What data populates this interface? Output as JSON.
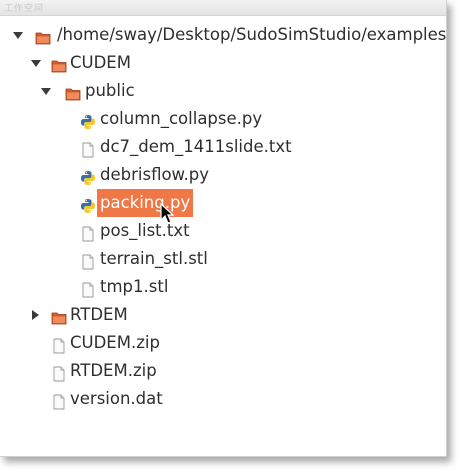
{
  "window": {
    "title": "工作空间"
  },
  "colors": {
    "selection": "#f07746",
    "folder": "#e05a2b"
  },
  "tree": [
    {
      "label": "/home/sway/Desktop/SudoSimStudio/examples",
      "icon": "folder-icon",
      "expander": "expanded",
      "depth": 0
    },
    {
      "label": "CUDEM",
      "icon": "folder-icon",
      "expander": "expanded",
      "depth": 1
    },
    {
      "label": "public",
      "icon": "folder-icon",
      "expander": "expanded",
      "depth": 2
    },
    {
      "label": "column_collapse.py",
      "icon": "python-file-icon",
      "expander": "none",
      "depth": 3
    },
    {
      "label": "dc7_dem_1411slide.txt",
      "icon": "text-file-icon",
      "expander": "none",
      "depth": 3
    },
    {
      "label": "debrisflow.py",
      "icon": "python-file-icon",
      "expander": "none",
      "depth": 3
    },
    {
      "label": "packing.py",
      "icon": "python-file-icon",
      "expander": "none",
      "depth": 3,
      "selected": true
    },
    {
      "label": "pos_list.txt",
      "icon": "text-file-icon",
      "expander": "none",
      "depth": 3
    },
    {
      "label": "terrain_stl.stl",
      "icon": "text-file-icon",
      "expander": "none",
      "depth": 3
    },
    {
      "label": "tmp1.stl",
      "icon": "text-file-icon",
      "expander": "none",
      "depth": 3
    },
    {
      "label": "RTDEM",
      "icon": "folder-icon",
      "expander": "collapsed",
      "depth": 1
    },
    {
      "label": "CUDEM.zip",
      "icon": "text-file-icon",
      "expander": "none",
      "depth": 1
    },
    {
      "label": "RTDEM.zip",
      "icon": "text-file-icon",
      "expander": "none",
      "depth": 1
    },
    {
      "label": "version.dat",
      "icon": "text-file-icon",
      "expander": "none",
      "depth": 1
    }
  ]
}
